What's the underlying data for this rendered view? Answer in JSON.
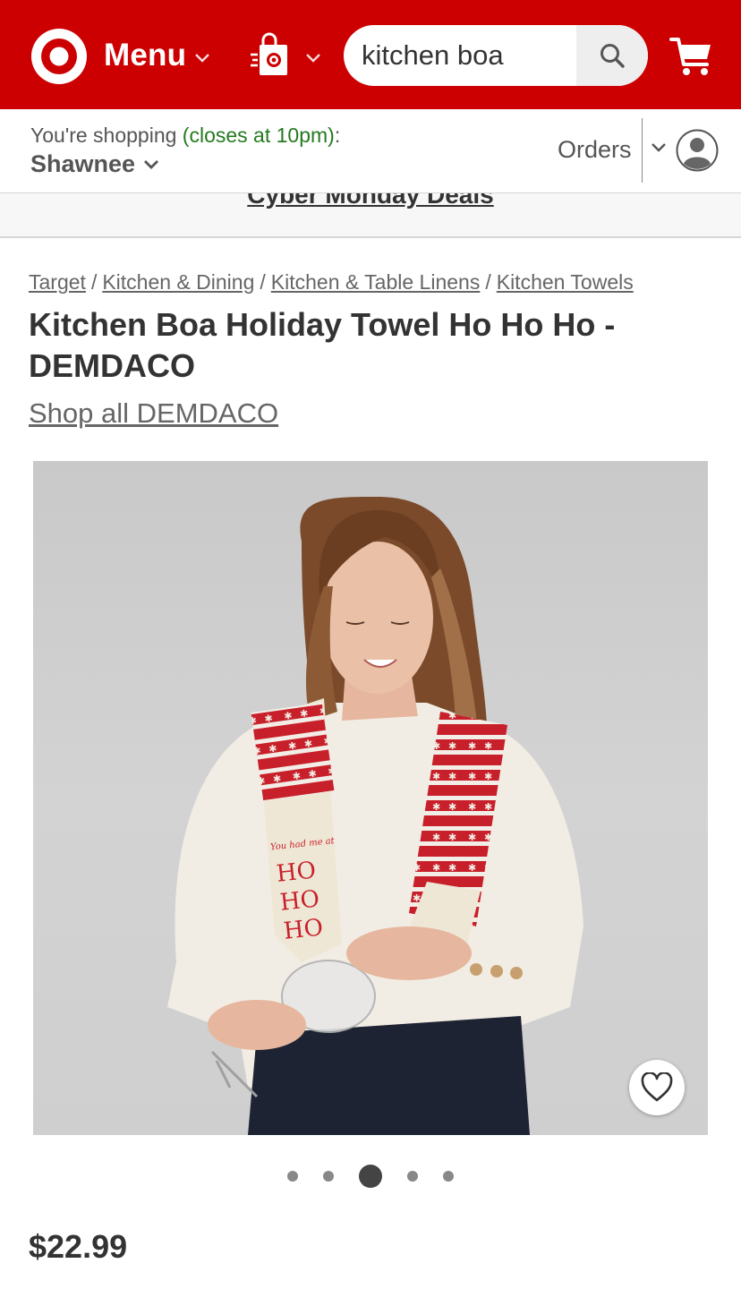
{
  "header": {
    "menu_label": "Menu",
    "search": {
      "value": "kitchen boa",
      "placeholder": "search"
    },
    "brand_color": "#cc0000"
  },
  "store_bar": {
    "shopping_prefix": "You're shopping",
    "closes_text": "(closes at 10pm)",
    "colon": ":",
    "store_name": "Shawnee",
    "orders_label": "Orders"
  },
  "banner": {
    "deals_label": "Cyber Monday Deals"
  },
  "breadcrumb": {
    "items": [
      "Target",
      "Kitchen & Dining",
      "Kitchen & Table Linens",
      "Kitchen Towels"
    ],
    "separator": "/"
  },
  "product": {
    "title": "Kitchen Boa Holiday Towel Ho Ho Ho - DEMDACO",
    "brand_link": "Shop all DEMDACO",
    "towel_text": [
      "You had me at",
      "HO",
      "HO",
      "HO"
    ],
    "price": "$22.99",
    "carousel": {
      "count": 5,
      "active_index": 2
    }
  },
  "icons": {
    "logo": "target-bullseye-icon",
    "store": "store-bag-icon",
    "search": "search-icon",
    "cart": "cart-icon",
    "account": "avatar-icon",
    "favorite": "heart-icon"
  }
}
